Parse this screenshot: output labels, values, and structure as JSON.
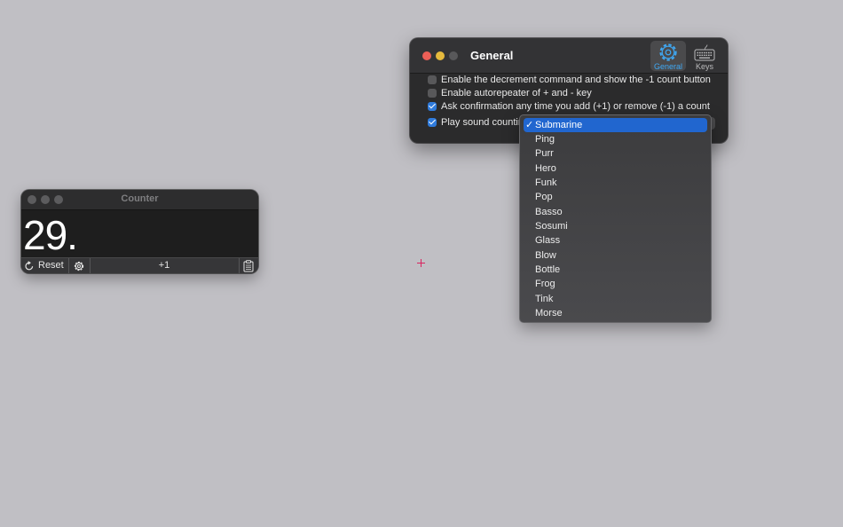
{
  "colors": {
    "desktop": "#c0bfc4",
    "accent_blue": "#2f7bdc",
    "tab_selected_text": "#3fa9f5",
    "menu_selection": "#2166cf",
    "close": "#ec5f57",
    "minimize": "#e5b93d",
    "zoom_inactive": "#58585a"
  },
  "counter_window": {
    "title": "Counter",
    "count": "29.",
    "toolbar": {
      "reset_label": "Reset",
      "increment_label": "+1",
      "icons": [
        "reset-arrow-icon",
        "gear-icon",
        "clipboard-icon"
      ]
    }
  },
  "prefs_window": {
    "title": "General",
    "tabs": [
      {
        "label": "General",
        "icon": "gear-icon",
        "selected": true
      },
      {
        "label": "Keys",
        "icon": "keyboard-icon",
        "selected": false
      }
    ],
    "options": [
      {
        "label": "Enable the decrement command and show the -1 count button",
        "checked": false
      },
      {
        "label": "Enable autorepeater of + and - key",
        "checked": false
      },
      {
        "label": "Ask confirmation any time you add (+1) or remove (-1) a count",
        "checked": true
      },
      {
        "label": "Play sound counting",
        "checked": true
      }
    ]
  },
  "sound_menu": {
    "selected": "Submarine",
    "check_glyph": "✓",
    "items": [
      "Submarine",
      "Ping",
      "Purr",
      "Hero",
      "Funk",
      "Pop",
      "Basso",
      "Sosumi",
      "Glass",
      "Blow",
      "Bottle",
      "Frog",
      "Tink",
      "Morse"
    ]
  }
}
